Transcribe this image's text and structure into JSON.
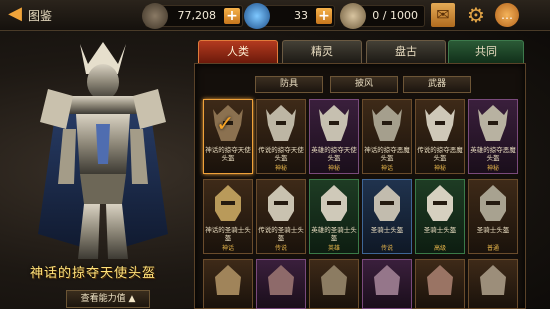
{
  "header": {
    "title": "图鉴",
    "gold": "77,208",
    "gems": "33",
    "bag": "0 / 1000"
  },
  "hero": {
    "item_name": "神话的掠夺天使头盔",
    "stats_button": "查看能力值 ▲"
  },
  "tabs": [
    "人类",
    "精灵",
    "盘古",
    "共同"
  ],
  "subtabs": [
    "防具",
    "披风",
    "武器"
  ],
  "grid": {
    "row1": [
      {
        "name": "神话的掠夺天使头盔",
        "rank": ""
      },
      {
        "name": "传说的掠夺天使头盔",
        "rank": "神秘"
      },
      {
        "name": "英雄的掠夺天使头盔",
        "rank": "神秘"
      },
      {
        "name": "神话的掠夺恶魔头盔",
        "rank": "神话"
      },
      {
        "name": "传说的掠夺恶魔头盔",
        "rank": "神秘"
      },
      {
        "name": "英雄的掠夺恶魔头盔",
        "rank": "神秘"
      }
    ],
    "row2": [
      {
        "name": "神话的圣骑士头盔",
        "rank": "神话"
      },
      {
        "name": "传说的圣骑士头盔",
        "rank": "传说"
      },
      {
        "name": "英雄的圣骑士头盔",
        "rank": "英雄"
      },
      {
        "name": "圣骑士头盔",
        "rank": "传说"
      },
      {
        "name": "圣骑士头盔",
        "rank": "高级"
      },
      {
        "name": "圣骑士头盔",
        "rank": "普通"
      }
    ]
  },
  "colors": {
    "accent": "#f0a23a",
    "tab_active": "#b33a1f",
    "name_gold": "#ffe27a"
  }
}
